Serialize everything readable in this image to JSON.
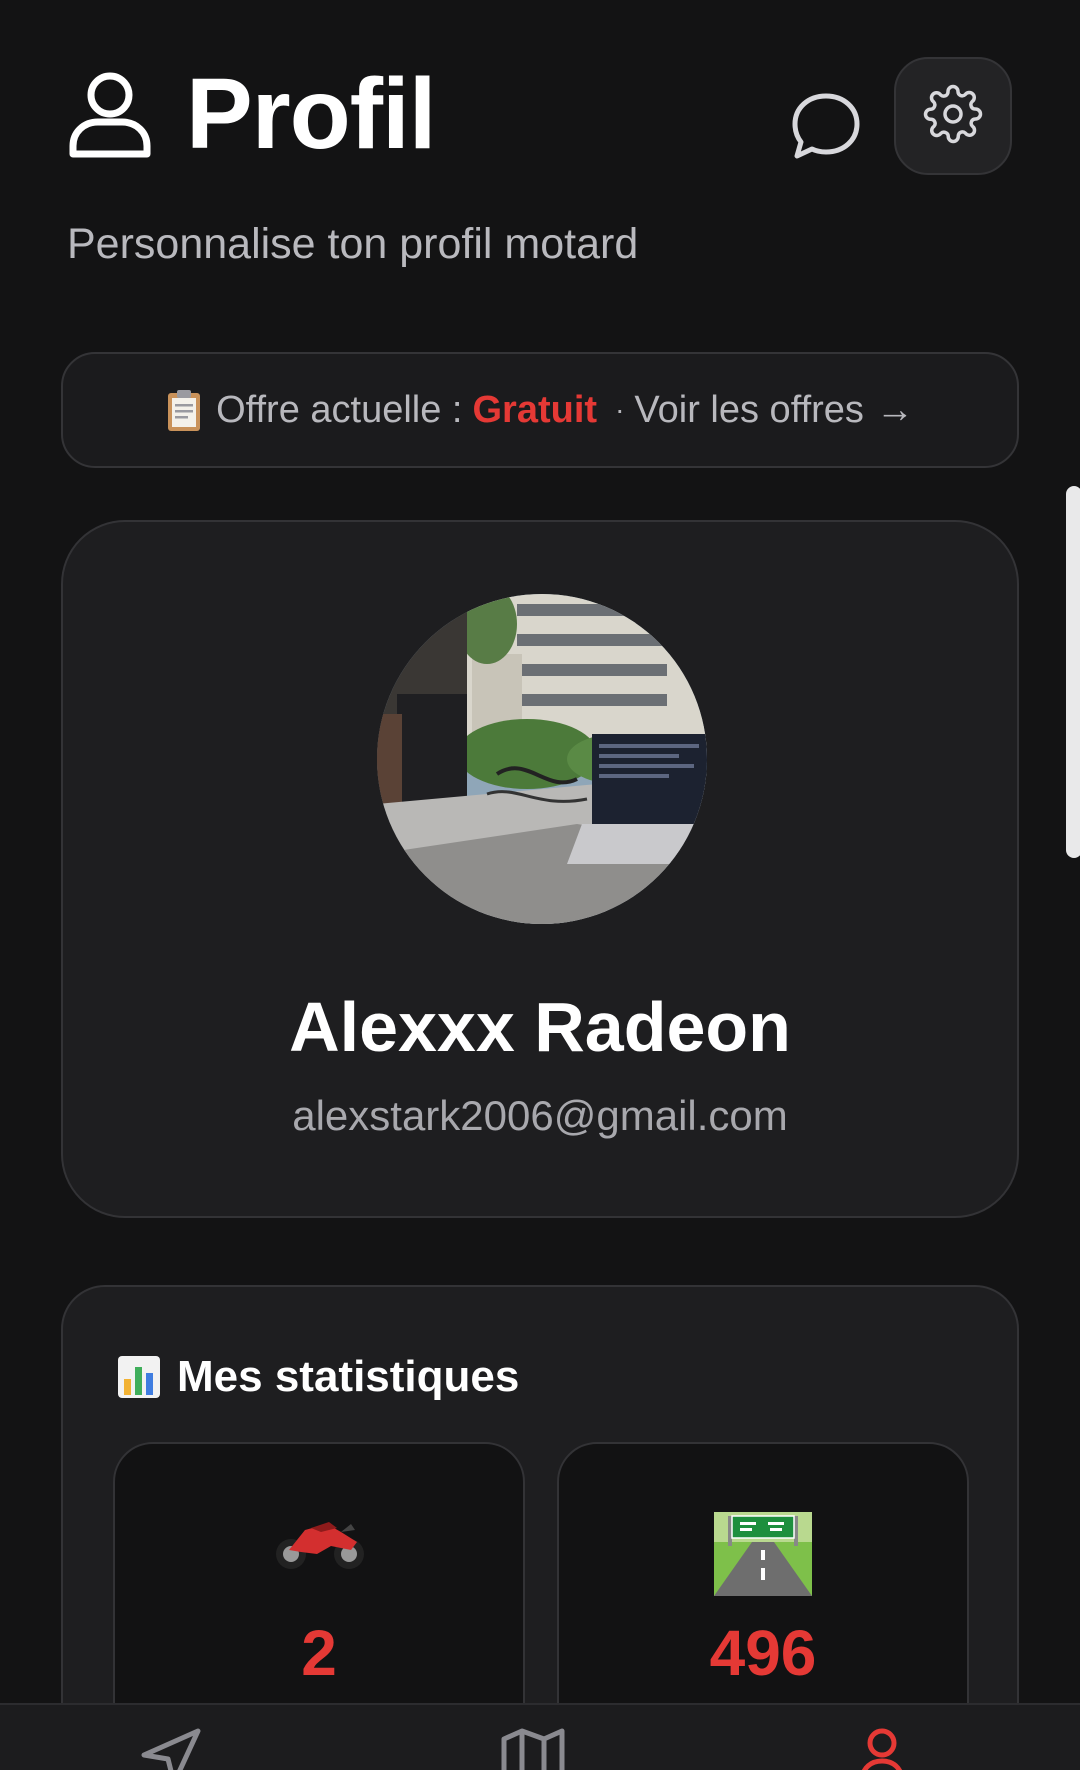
{
  "header": {
    "title": "Profil",
    "subtitle": "Personnalise ton profil motard",
    "chat_icon": "chat-bubble-icon",
    "settings_icon": "gear-icon"
  },
  "offer": {
    "label": "Offre actuelle :",
    "plan": "Gratuit",
    "separator": "·",
    "link": "Voir les offres",
    "arrow": "→",
    "icon": "clipboard-icon"
  },
  "profile": {
    "name": "Alexxx Radeon",
    "email": "alexstark2006@gmail.com",
    "avatar_description": "photo-avatar"
  },
  "stats": {
    "title": "Mes statistiques",
    "icon": "bar-chart-icon",
    "items": [
      {
        "icon": "motorcycle-icon",
        "value": "2"
      },
      {
        "icon": "highway-icon",
        "value": "496"
      }
    ]
  },
  "nav": {
    "items": [
      {
        "icon": "navigation-arrow-icon",
        "active": false
      },
      {
        "icon": "map-icon",
        "active": false
      },
      {
        "icon": "profile-icon",
        "active": true
      }
    ]
  },
  "colors": {
    "accent": "#e53935",
    "background": "#131314",
    "card": "#1e1e20",
    "muted_text": "#b8b8bd"
  }
}
